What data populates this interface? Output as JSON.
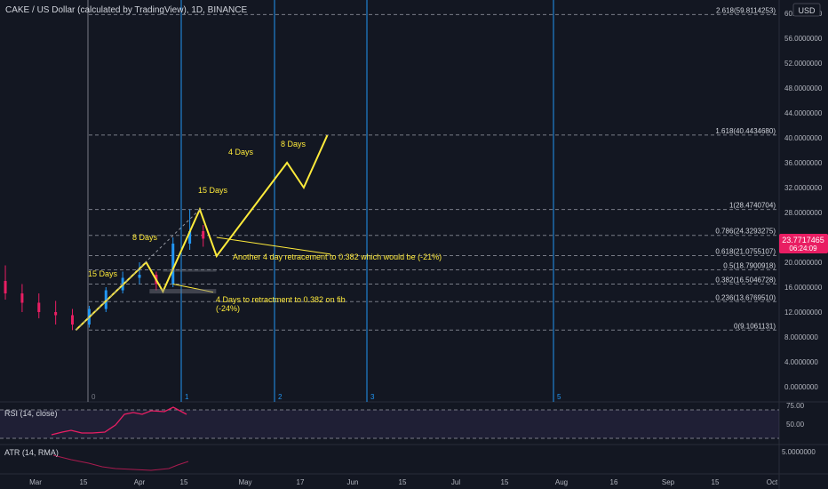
{
  "header": {
    "title": "CAKE / US Dollar (calculated by TradingView), 1D, BINANCE"
  },
  "price_axis": {
    "currency": "USD",
    "ticks": [
      "60.0000000",
      "56.0000000",
      "52.0000000",
      "48.0000000",
      "44.0000000",
      "40.0000000",
      "36.0000000",
      "32.0000000",
      "28.0000000",
      "24.0000000",
      "20.0000000",
      "16.0000000",
      "12.0000000",
      "8.0000000",
      "4.0000000",
      "0.0000000"
    ],
    "current_price": "23.7717465",
    "countdown": "06:24:09"
  },
  "time_axis": {
    "labels": [
      "Mar",
      "15",
      "Apr",
      "15",
      "May",
      "17",
      "Jun",
      "15",
      "Jul",
      "15",
      "Aug",
      "16",
      "Sep",
      "15",
      "Oct"
    ]
  },
  "fib_levels": [
    {
      "label": "2.618(59.8114253)",
      "value": 59.8114253
    },
    {
      "label": "1.618(40.4434680)",
      "value": 40.443468
    },
    {
      "label": "1(28.4740704)",
      "value": 28.4740704
    },
    {
      "label": "0.786(24.3293275)",
      "value": 24.3293275
    },
    {
      "label": "0.618(21.0755107)",
      "value": 21.0755107
    },
    {
      "label": "0.5(18.7900918)",
      "value": 18.7900918
    },
    {
      "label": "0.382(16.5046728)",
      "value": 16.5046728
    },
    {
      "label": "0.236(13.6769510)",
      "value": 13.676951
    },
    {
      "label": "0(9.1061131)",
      "value": 9.1061131
    }
  ],
  "time_cycles": [
    "0",
    "1",
    "2",
    "3",
    "5"
  ],
  "annotations": {
    "a15days_1": "15 Days",
    "a8days_1": "8 Days",
    "a15days_2": "15 Days",
    "a4days": "4 Days",
    "a8days_2": "8 Days",
    "retrace1": "Another 4 day retracement to 0.382 which would be (-21%)",
    "retrace2_line1": "4 Days to retractment to 0.382 on fib",
    "retrace2_line2": "(-24%)"
  },
  "rsi": {
    "label": "RSI (14, close)",
    "ticks": [
      "75.00",
      "50.00"
    ]
  },
  "atr": {
    "label": "ATR (14, RMA)",
    "ticks": [
      "5.0000000"
    ]
  },
  "colors": {
    "background": "#131722",
    "up": "#2196f3",
    "down": "#e91e63",
    "projection": "#ffeb3b",
    "fib": "#787b86",
    "cycle": "#2196f3",
    "rsi_line": "#e91e63",
    "price_tag": "#e91e63"
  },
  "chart_data": {
    "type": "candlestick",
    "symbol": "CAKE/USD",
    "timeframe": "1D",
    "ylim": [
      0,
      61.5
    ],
    "projection_path": {
      "name": "",
      "points": [
        [
          "2021-03-13",
          9.1
        ],
        [
          "2021-04-03",
          20.0
        ],
        [
          "2021-04-08",
          15.3
        ],
        [
          "2021-04-19",
          28.5
        ],
        [
          "2021-04-24",
          21.0
        ],
        [
          "2021-05-15",
          36.0
        ],
        [
          "2021-05-20",
          32.0
        ],
        [
          "2021-05-27",
          40.4
        ]
      ]
    },
    "candles_approx": [
      [
        "2021-02-15",
        14.5,
        21.0,
        11.0,
        17.0
      ],
      [
        "2021-02-20",
        17.0,
        19.5,
        14.0,
        15.0
      ],
      [
        "2021-02-25",
        15.0,
        16.5,
        12.0,
        13.5
      ],
      [
        "2021-03-02",
        13.5,
        15.0,
        11.0,
        12.0
      ],
      [
        "2021-03-07",
        12.0,
        13.8,
        10.0,
        11.5
      ],
      [
        "2021-03-12",
        11.5,
        12.5,
        9.1,
        10.0
      ],
      [
        "2021-03-17",
        10.0,
        13.0,
        9.5,
        12.5
      ],
      [
        "2021-03-22",
        12.5,
        16.0,
        12.0,
        15.5
      ],
      [
        "2021-03-27",
        15.5,
        18.5,
        15.0,
        17.5
      ],
      [
        "2021-04-01",
        17.5,
        20.0,
        16.5,
        18.0
      ],
      [
        "2021-04-06",
        18.0,
        18.5,
        15.5,
        16.5
      ],
      [
        "2021-04-11",
        16.5,
        24.0,
        16.0,
        23.0
      ],
      [
        "2021-04-16",
        23.0,
        28.5,
        22.0,
        25.0
      ],
      [
        "2021-04-20",
        25.0,
        26.0,
        22.5,
        23.8
      ]
    ]
  }
}
